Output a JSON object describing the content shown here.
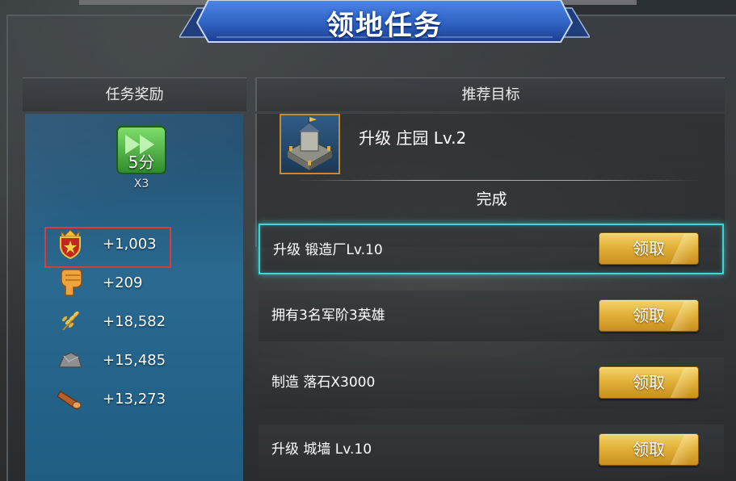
{
  "title": "领地任务",
  "rewards": {
    "header": "任务奖励",
    "speedup": {
      "label": "5分",
      "count": "X3"
    },
    "items": [
      {
        "icon": "shield-crown-icon",
        "value": "+1,003"
      },
      {
        "icon": "fist-icon",
        "value": "+209"
      },
      {
        "icon": "wheat-icon",
        "value": "+18,582"
      },
      {
        "icon": "stone-icon",
        "value": "+15,485"
      },
      {
        "icon": "wood-log-icon",
        "value": "+13,273"
      }
    ]
  },
  "objectives": {
    "header": "推荐目标",
    "recommended": {
      "icon": "castle-icon",
      "title": "升级  庄园 Lv.2",
      "status": "完成"
    },
    "tasks": [
      {
        "label": "升级  锻造厂Lv.10",
        "button": "领取",
        "active": true
      },
      {
        "label": "拥有3名军阶3英雄",
        "button": "领取",
        "active": false
      },
      {
        "label": "制造  落石X3000",
        "button": "领取",
        "active": false
      },
      {
        "label": "升级  城墙 Lv.10",
        "button": "领取",
        "active": false
      }
    ]
  },
  "colors": {
    "accent_cyan": "#3fd6d8",
    "button_gold": "#e2b23a",
    "banner_blue": "#2f63c4",
    "highlight_red": "#e0393b",
    "speedup_green": "#3fae3a"
  }
}
